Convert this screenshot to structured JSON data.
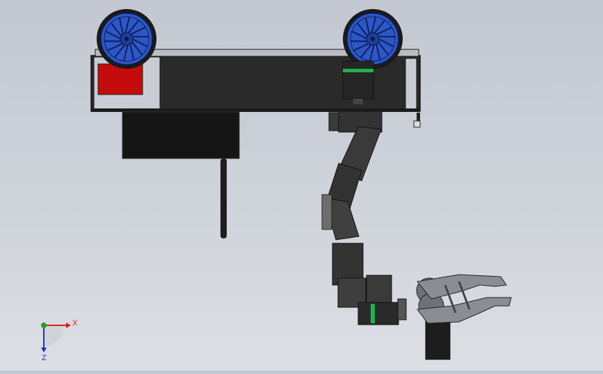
{
  "viewport": {
    "background_top": "#c2c7d1",
    "background_bottom": "#dcdfe4"
  },
  "model": {
    "chassis_color": "#2a2a2a",
    "chassis_outline": "#111111",
    "wheel_color": "#2d57c8",
    "wheel_hub_color": "#1d3d9a",
    "battery_color": "#c40c0c",
    "motor_band_color": "#22b14c",
    "arm_color": "#3a3a3a",
    "gripper_color": "#8a8d93"
  },
  "triad": {
    "x_label": "X",
    "z_label": "Z",
    "x_color": "#d42020",
    "y_color": "#20a020",
    "z_color": "#2030c8"
  }
}
